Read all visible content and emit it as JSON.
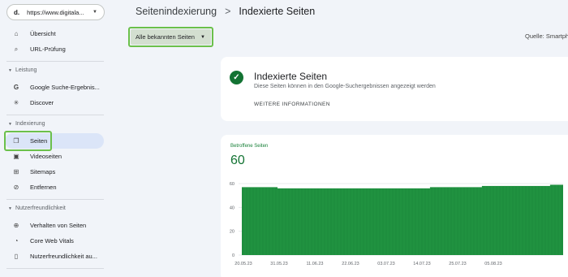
{
  "property": {
    "logo": "d.",
    "url": "https://www.digitala..."
  },
  "nav": {
    "overview": "Übersicht",
    "url_inspection": "URL-Prüfung",
    "section_performance": "Leistung",
    "google_search": "Google Suche-Ergebnis...",
    "discover": "Discover",
    "section_indexing": "Indexierung",
    "pages": "Seiten",
    "video_pages": "Videoseiten",
    "sitemaps": "Sitemaps",
    "removals": "Entfernen",
    "section_experience": "Nutzerfreundlichkeit",
    "page_experience": "Verhalten von Seiten",
    "core_web_vitals": "Core Web Vitals",
    "mobile_usability": "Nutzerfreundlichkeit au..."
  },
  "breadcrumb": {
    "parent": "Seitenindexierung",
    "separator": ">",
    "current": "Indexierte Seiten"
  },
  "filter": {
    "label": "Alle bekannten Seiten"
  },
  "source": {
    "label": "Quelle: Smartpho"
  },
  "info_card": {
    "title": "Indexierte Seiten",
    "description": "Diese Seiten können in den Google-Suchergebnissen angezeigt werden",
    "link": "WEITERE INFORMATIONEN"
  },
  "metric": {
    "label": "Betroffene Seiten",
    "value": "60"
  },
  "colors": {
    "bar": "#1e8e3e",
    "accent": "#137333",
    "highlight": "#6bc04b"
  },
  "chart_data": {
    "type": "bar",
    "title": "",
    "xlabel": "",
    "ylabel": "",
    "ylim": [
      0,
      60
    ],
    "yticks": [
      0,
      20,
      40,
      60
    ],
    "xticks": [
      "20.05.23",
      "31.05.23",
      "11.06.23",
      "22.06.23",
      "03.07.23",
      "14.07.23",
      "25.07.23",
      "05.08.23"
    ],
    "series": [
      {
        "values": [
          57,
          57,
          57,
          57,
          57,
          57,
          57,
          57,
          57,
          57,
          57,
          56,
          56,
          56,
          56,
          56,
          56,
          56,
          56,
          56,
          56,
          56,
          56,
          56,
          56,
          56,
          56,
          56,
          56,
          56,
          56,
          56,
          56,
          56,
          56,
          56,
          56,
          56,
          56,
          56,
          56,
          56,
          56,
          56,
          56,
          56,
          56,
          56,
          56,
          56,
          56,
          56,
          56,
          56,
          56,
          56,
          56,
          56,
          57,
          57,
          57,
          57,
          57,
          57,
          57,
          57,
          57,
          57,
          57,
          57,
          57,
          57,
          57,
          57,
          58,
          58,
          58,
          58,
          58,
          58,
          58,
          58,
          58,
          58,
          58,
          58,
          58,
          58,
          58,
          58,
          58,
          58,
          58,
          58,
          58,
          59,
          59,
          59,
          59
        ]
      }
    ]
  }
}
